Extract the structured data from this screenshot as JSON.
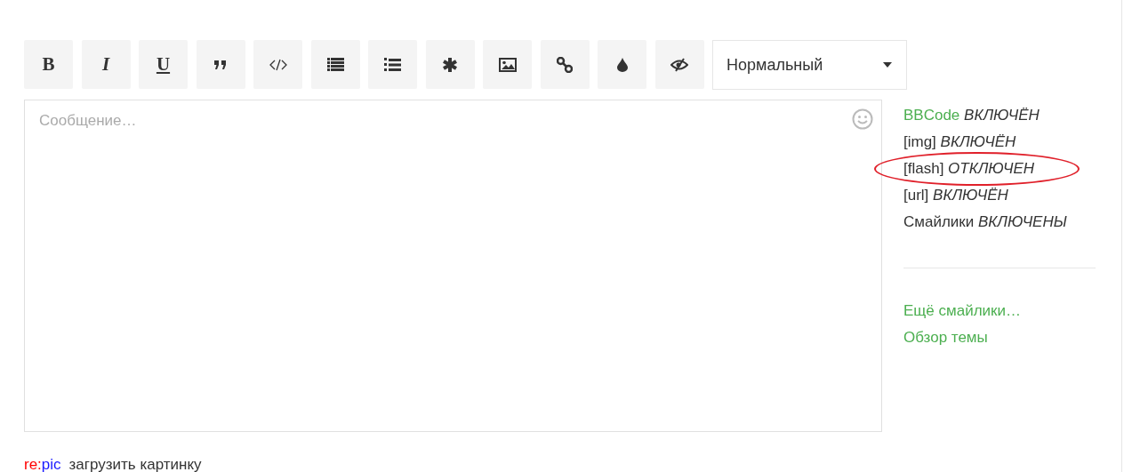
{
  "toolbar": {
    "buttons": [
      {
        "kind": "bold",
        "label": "B"
      },
      {
        "kind": "italic",
        "label": "I"
      },
      {
        "kind": "underline",
        "label": "U"
      },
      {
        "kind": "quote"
      },
      {
        "kind": "code"
      },
      {
        "kind": "list"
      },
      {
        "kind": "ordered-list"
      },
      {
        "kind": "asterisk"
      },
      {
        "kind": "image"
      },
      {
        "kind": "link"
      },
      {
        "kind": "color"
      },
      {
        "kind": "hide"
      }
    ],
    "font_size": {
      "value": "Нормальный"
    }
  },
  "message": {
    "placeholder": "Сообщение…"
  },
  "settings": [
    {
      "kind": "link",
      "label": "BBCode",
      "status": "ВКЛЮЧЁН",
      "highlighted": false
    },
    {
      "kind": "text",
      "label": "[img]",
      "status": "ВКЛЮЧЁН",
      "highlighted": false
    },
    {
      "kind": "text",
      "label": "[flash]",
      "status": "ОТКЛЮЧЕН",
      "highlighted": true
    },
    {
      "kind": "text",
      "label": "[url]",
      "status": "ВКЛЮЧЁН",
      "highlighted": false
    },
    {
      "kind": "text",
      "label": "Смайлики",
      "status": "ВКЛЮЧЕНЫ",
      "highlighted": false
    }
  ],
  "links": [
    "Ещё смайлики…",
    "Обзор темы"
  ],
  "uploader": {
    "logo": [
      {
        "text": "re:",
        "color": "#ff0000"
      },
      {
        "text": "pic",
        "color": "#1a1aff"
      }
    ],
    "label": "загрузить картинку"
  }
}
